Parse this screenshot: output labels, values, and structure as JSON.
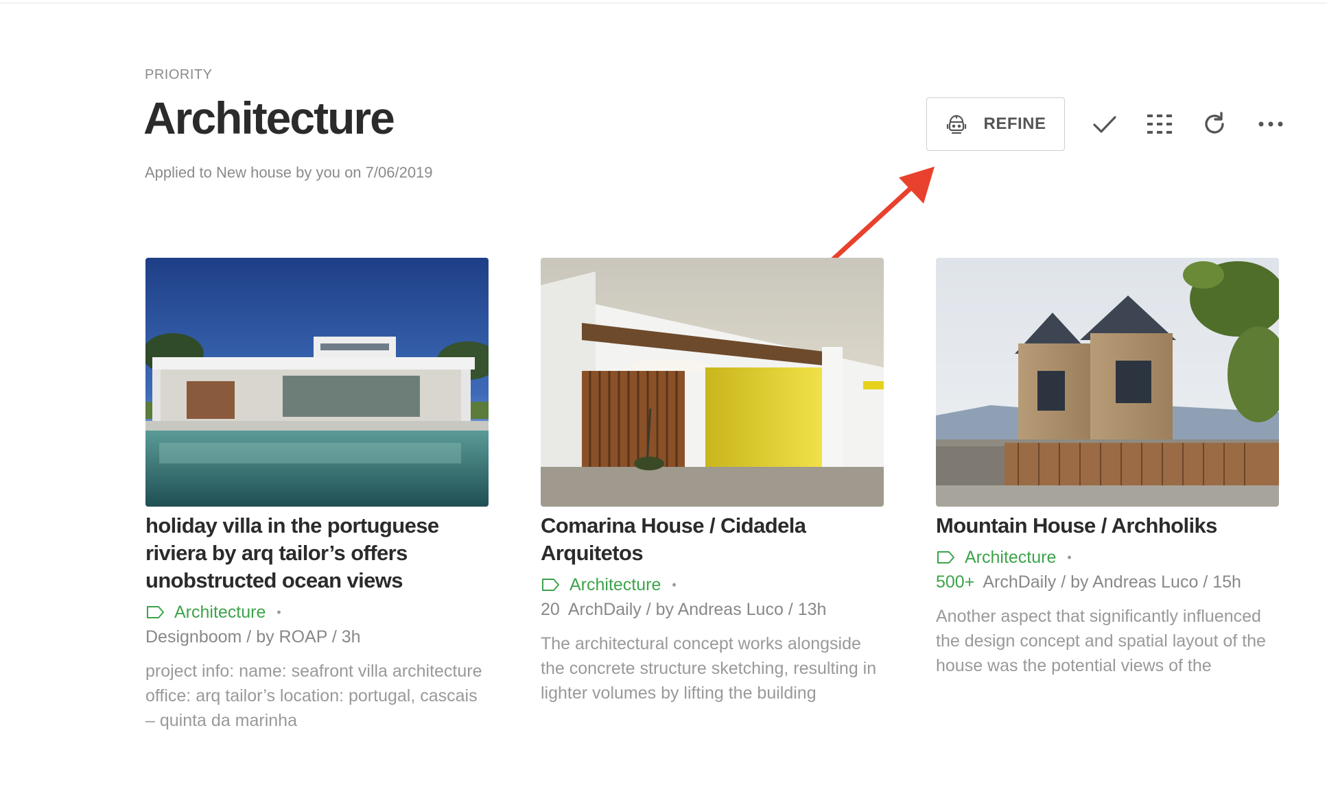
{
  "header": {
    "eyebrow": "PRIORITY",
    "title": "Architecture",
    "subtitle": "Applied to New house by you on 7/06/2019"
  },
  "toolbar": {
    "refine_label": "REFINE",
    "icons": [
      "robot-icon",
      "check-icon",
      "grid-icon",
      "refresh-icon",
      "more-icon"
    ]
  },
  "colors": {
    "accent_green": "#3ca34a",
    "arrow_red": "#e8412d",
    "title_dark": "#2b2b2b",
    "muted_gray": "#8a8a8a"
  },
  "cards": [
    {
      "title": "holiday villa in the portuguese riviera by arq tailor’s offers unobstructed ocean views",
      "tag": "Architecture",
      "count": "",
      "meta": "Designboom / by ROAP / 3h",
      "excerpt": "project info: name: seafront villa architecture office: arq tailor’s location: portugal, cascais – quinta da marinha"
    },
    {
      "title": "Comarina House / Cidadela Arquitetos",
      "tag": "Architecture",
      "count": "20",
      "meta": "ArchDaily / by Andreas Luco / 13h",
      "excerpt": "The architectural concept works alongside the concrete structure sketching, resulting in lighter volumes by lifting the building"
    },
    {
      "title": "Mountain House / Archholiks",
      "tag": "Architecture",
      "count": "500+",
      "meta": "ArchDaily / by Andreas Luco / 15h",
      "excerpt": "Another aspect that significantly influenced the design concept and spatial layout of the house was the potential views of the"
    }
  ]
}
